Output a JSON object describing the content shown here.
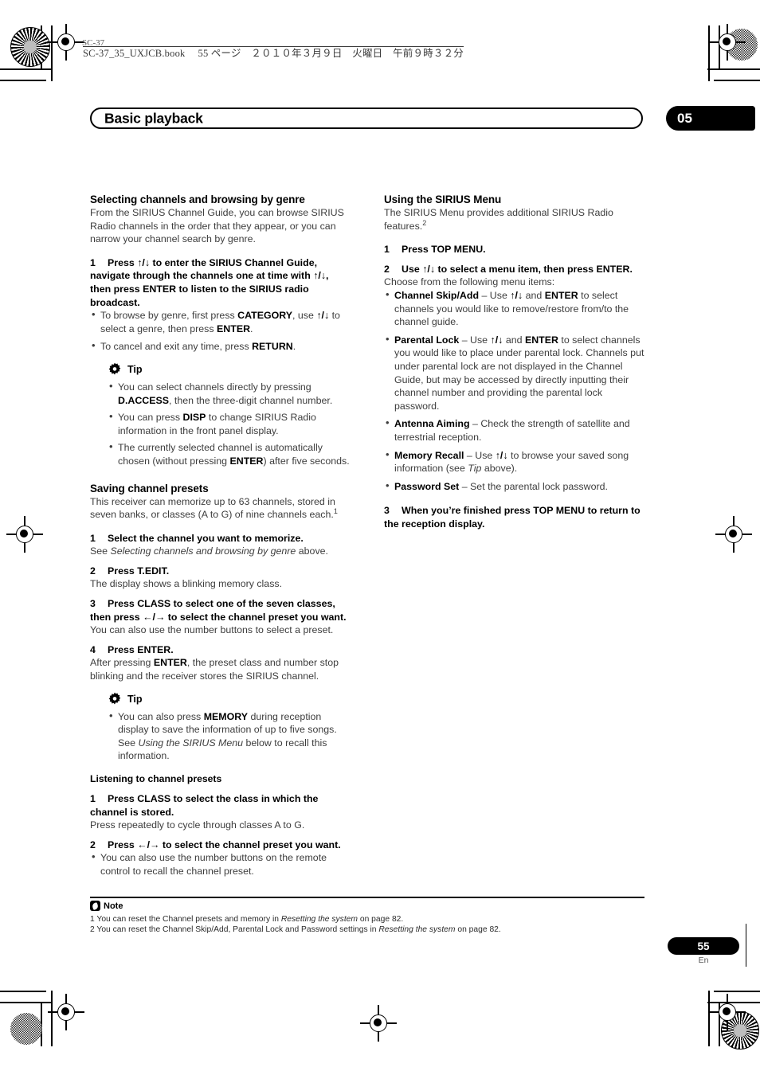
{
  "print_marks": {
    "slug_text": "SC-37_35_UXJCB.book  55 ページ ２０１０年３月９日　火曜日　午前９時３２分",
    "corner_label": "SC-37"
  },
  "header": {
    "title": "Basic playback",
    "chapter_number": "05"
  },
  "left_column": {
    "section1": {
      "heading": "Selecting channels and browsing by genre",
      "intro": "From the SIRIUS Channel Guide, you can browse SIRIUS Radio channels in the order that they appear, or you can narrow your channel search by genre.",
      "steps": [
        {
          "number": "1",
          "text_html": "Press <b>↑/↓</b> to enter the SIRIUS Channel Guide, navigate through the channels one at time with <b>↑/↓</b>, then press ENTER to listen to the SIRIUS radio broadcast.",
          "bullets_html": [
            "To browse by genre, first press <b>CATEGORY</b>, use <b>↑/↓</b> to select a genre, then press <b>ENTER</b>.",
            "To cancel and exit any time, press <b>RETURN</b>."
          ]
        }
      ],
      "tip": {
        "icon": "gear-icon",
        "label": "Tip",
        "bullets_html": [
          "You can select channels directly by pressing <b>D.ACCESS</b>, then the three-digit channel number.",
          "You can press <b>DISP</b> to change SIRIUS Radio information in the front panel display.",
          "The currently selected channel is automatically chosen (without pressing <b>ENTER</b>) after five seconds."
        ]
      }
    },
    "section2": {
      "heading": "Saving channel presets",
      "intro_html": "This receiver can memorize up to 63 channels, stored in seven banks, or classes (A to G) of nine channels each.<sup>1</sup>",
      "steps": [
        {
          "number": "1",
          "text_html": "Select the channel you want to memorize.",
          "sub_html": "See <i>Selecting channels and browsing by genre</i> above."
        },
        {
          "number": "2",
          "text_html": "Press T.EDIT.",
          "sub_html": "The display shows a blinking memory class."
        },
        {
          "number": "3",
          "text_html": "Press CLASS to select one of the seven classes, then press <b>←/→</b> to select the channel preset you want.",
          "sub_html": "You can also use the number buttons to select a preset."
        },
        {
          "number": "4",
          "text_html": "Press ENTER.",
          "sub_html": "After pressing <b>ENTER</b>, the preset class and number stop blinking and the receiver stores the SIRIUS channel."
        }
      ],
      "tip": {
        "icon": "gear-icon",
        "label": "Tip",
        "bullets_html": [
          "You can also press <b>MEMORY</b> during reception display to save the information of up to five songs. See <i>Using the SIRIUS Menu</i> below to recall this information."
        ]
      }
    },
    "section3": {
      "heading": "Listening to channel presets",
      "steps": [
        {
          "number": "1",
          "text_html": "Press CLASS to select the class in which the channel is stored.",
          "sub_html": "Press repeatedly to cycle through classes A to G."
        },
        {
          "number": "2",
          "text_html": "Press <b>←/→</b> to select the channel preset you want.",
          "bullets_html": [
            "You can also use the number buttons on the remote control to recall the channel preset."
          ]
        }
      ]
    }
  },
  "right_column": {
    "section1": {
      "heading": "Using the SIRIUS Menu",
      "intro_html": "The SIRIUS Menu provides additional SIRIUS Radio features.<sup>2</sup>",
      "steps": [
        {
          "number": "1",
          "text_html": "Press TOP MENU."
        },
        {
          "number": "2",
          "text_html": "Use <b>↑/↓</b> to select a menu item, then press ENTER.",
          "sub_html": "Choose from the following menu items:",
          "bullets_html": [
            "<b>Channel Skip/Add</b> – Use <b>↑/↓</b> and <b>ENTER</b> to select channels you would like to remove/restore from/to the channel guide.",
            "<b>Parental Lock</b> – Use <b>↑/↓</b> and <b>ENTER</b> to select channels you would like to place under parental lock. Channels put under parental lock are not displayed in the Channel Guide, but may be accessed by directly inputting their channel number and providing the parental lock password.",
            "<b>Antenna Aiming</b> – Check the strength of satellite and terrestrial reception.",
            "<b>Memory Recall</b> – Use <b>↑/↓</b> to browse your saved song information (see <i>Tip</i> above).",
            "<b>Password Set</b> – Set the parental lock password."
          ]
        },
        {
          "number": "3",
          "text_html": "When you’re finished press TOP MENU to return to the reception display."
        }
      ]
    }
  },
  "notes": {
    "icon": "note-icon",
    "label": "Note",
    "items_html": [
      "1 You can reset the Channel presets and memory in <i>Resetting the system</i> on page 82.",
      "2 You can reset the Channel Skip/Add, Parental Lock and Password settings in <i>Resetting the system</i> on page 82."
    ]
  },
  "footer": {
    "page_number": "55",
    "language": "En"
  }
}
